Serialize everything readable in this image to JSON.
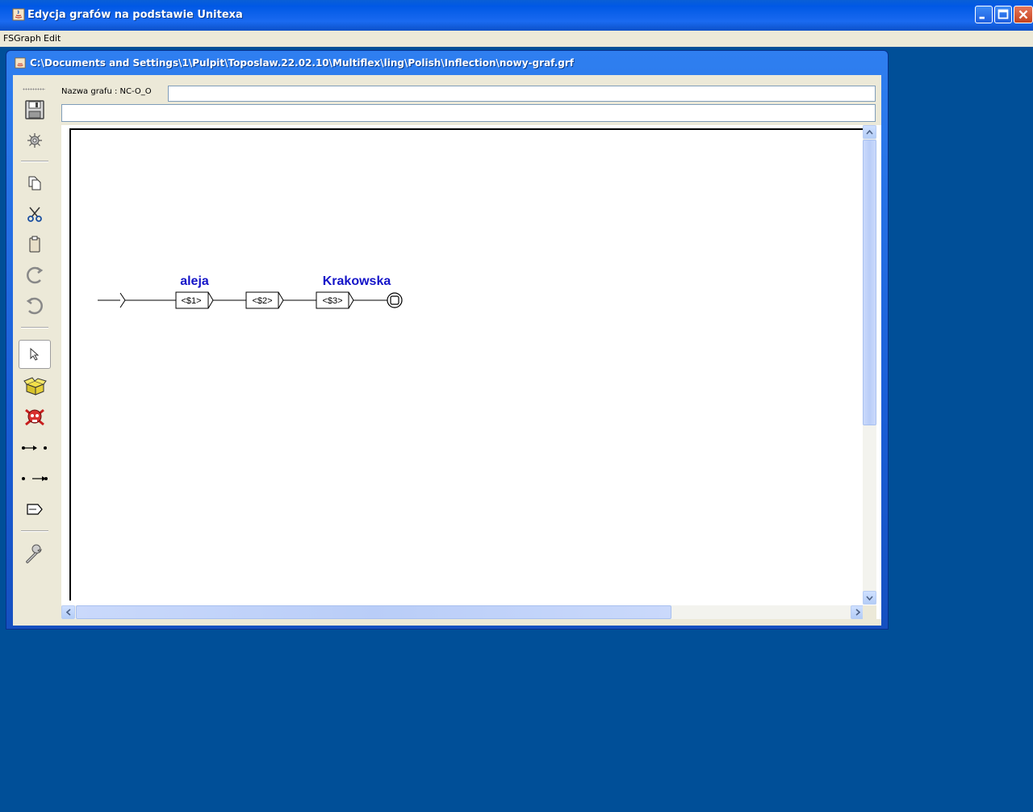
{
  "app": {
    "title": "Edycja grafów na podstawie Unitexa",
    "menu": [
      "FSGraph",
      "Edit"
    ]
  },
  "frame": {
    "title": "C:\\Documents and Settings\\1\\Pulpit\\Toposlaw.22.02.10\\Multiflex\\ling\\Polish\\Inflection\\nowy-graf.grf"
  },
  "header": {
    "graph_name_label": "Nazwa grafu : NC-O_O",
    "graph_name_value": "",
    "second_field_value": ""
  },
  "toolbar": {
    "tools": [
      {
        "name": "save",
        "icon": "floppy-disk-icon"
      },
      {
        "name": "compile",
        "icon": "gear-icon"
      },
      {
        "name": "copy",
        "icon": "copy-icon"
      },
      {
        "name": "cut",
        "icon": "scissors-icon"
      },
      {
        "name": "paste",
        "icon": "clipboard-icon"
      },
      {
        "name": "redo",
        "icon": "redo-icon"
      },
      {
        "name": "undo",
        "icon": "undo-icon"
      },
      {
        "name": "select",
        "icon": "arrow-pointer-icon",
        "selected": true
      },
      {
        "name": "create-box",
        "icon": "open-box-icon"
      },
      {
        "name": "delete",
        "icon": "skull-icon"
      },
      {
        "name": "link-forward",
        "icon": "link-forward-icon"
      },
      {
        "name": "link-backward",
        "icon": "link-backward-icon"
      },
      {
        "name": "open-subgraph",
        "icon": "graph-box-icon"
      },
      {
        "name": "configure",
        "icon": "wrench-icon"
      }
    ]
  },
  "graph": {
    "boxes": [
      {
        "label": "<$1>",
        "output": "aleja"
      },
      {
        "label": "<$2>",
        "output": ""
      },
      {
        "label": "<$3>",
        "output": "Krakowska"
      }
    ],
    "output_color": "#1414c8"
  }
}
